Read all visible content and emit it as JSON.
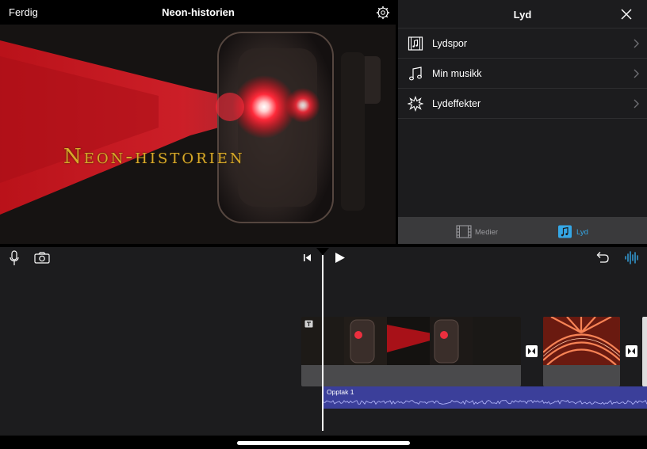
{
  "viewer": {
    "done_label": "Ferdig",
    "project_title": "Neon-historien",
    "overlay_title": "Neon-historien"
  },
  "panel": {
    "title": "Lyd",
    "items": [
      {
        "label": "Lydspor",
        "icon": "film-music-icon"
      },
      {
        "label": "Min musikk",
        "icon": "music-note-icon"
      },
      {
        "label": "Lydeffekter",
        "icon": "burst-icon"
      }
    ],
    "tabs": [
      {
        "label": "Medier",
        "icon": "film-strip-icon",
        "active": false
      },
      {
        "label": "Lyd",
        "icon": "music-note-icon",
        "active": true
      }
    ]
  },
  "timeline": {
    "audio_label": "Opptak 1"
  },
  "colors": {
    "accent": "#35a7e6",
    "audio_track": "#3b3f9a",
    "title_gold": "#d8a92a"
  }
}
